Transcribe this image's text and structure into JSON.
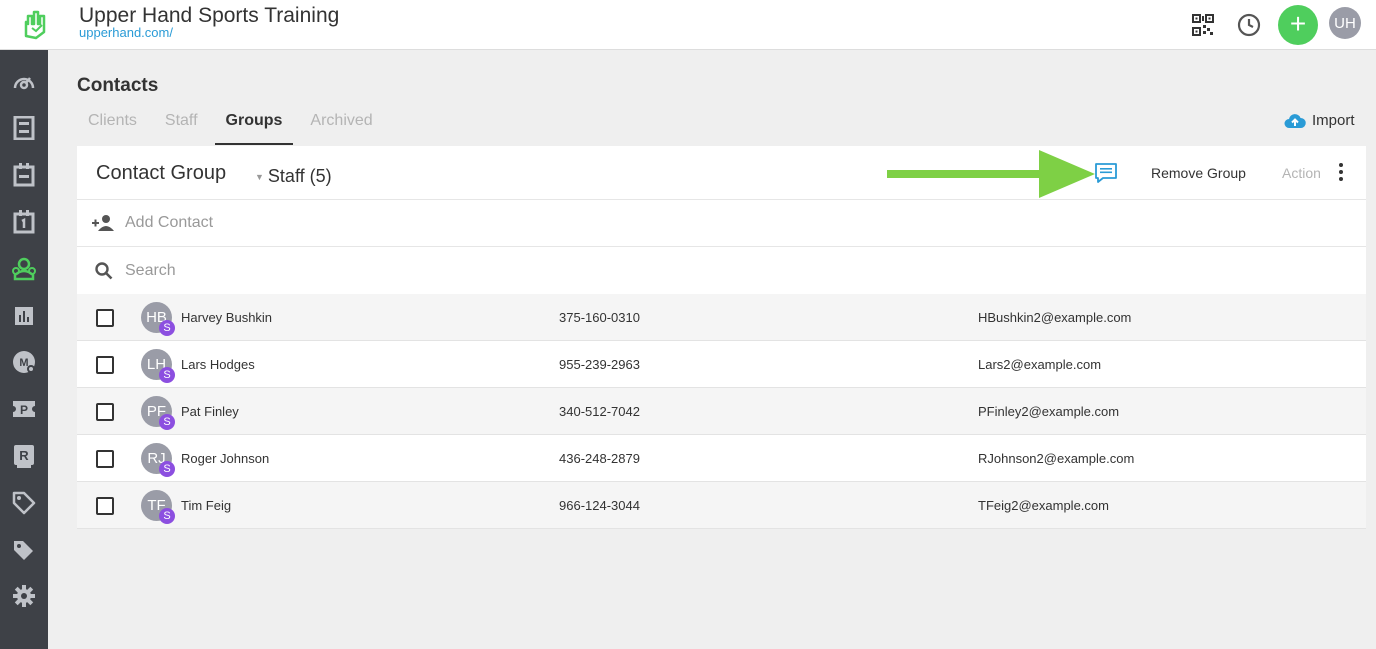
{
  "header": {
    "title": "Upper Hand Sports Training",
    "url": "upperhand.com/",
    "user_initials": "UH",
    "add_label": "+",
    "accent_green": "#4fce5d"
  },
  "sidebar": {
    "items": [
      {
        "icon": "dashboard-icon"
      },
      {
        "icon": "book-icon"
      },
      {
        "icon": "calendar-icon"
      },
      {
        "icon": "calendar-day-icon"
      },
      {
        "icon": "contacts-icon",
        "active": true
      },
      {
        "icon": "reports-icon"
      },
      {
        "icon": "marketing-icon"
      },
      {
        "icon": "pass-icon"
      },
      {
        "icon": "resources-icon"
      },
      {
        "icon": "tag-icon"
      },
      {
        "icon": "tags-icon"
      },
      {
        "icon": "settings-icon"
      }
    ]
  },
  "page": {
    "title": "Contacts",
    "tabs": [
      {
        "label": "Clients",
        "active": false
      },
      {
        "label": "Staff",
        "active": false
      },
      {
        "label": "Groups",
        "active": true
      },
      {
        "label": "Archived",
        "active": false
      }
    ],
    "import_label": "Import"
  },
  "group": {
    "label": "Contact Group",
    "selected": "Staff (5)",
    "remove_label": "Remove Group",
    "action_label": "Action",
    "add_contact_label": "Add Contact",
    "search_placeholder": "Search"
  },
  "contacts": [
    {
      "initials": "HB",
      "badge": "S",
      "name": "Harvey Bushkin",
      "phone": "375-160-0310",
      "email": "HBushkin2@example.com"
    },
    {
      "initials": "LH",
      "badge": "S",
      "name": "Lars Hodges",
      "phone": "955-239-2963",
      "email": "Lars2@example.com"
    },
    {
      "initials": "PF",
      "badge": "S",
      "name": "Pat Finley",
      "phone": "340-512-7042",
      "email": "PFinley2@example.com"
    },
    {
      "initials": "RJ",
      "badge": "S",
      "name": "Roger Johnson",
      "phone": "436-248-2879",
      "email": "RJohnson2@example.com"
    },
    {
      "initials": "TF",
      "badge": "S",
      "name": "Tim Feig",
      "phone": "966-124-3044",
      "email": "TFeig2@example.com"
    }
  ]
}
